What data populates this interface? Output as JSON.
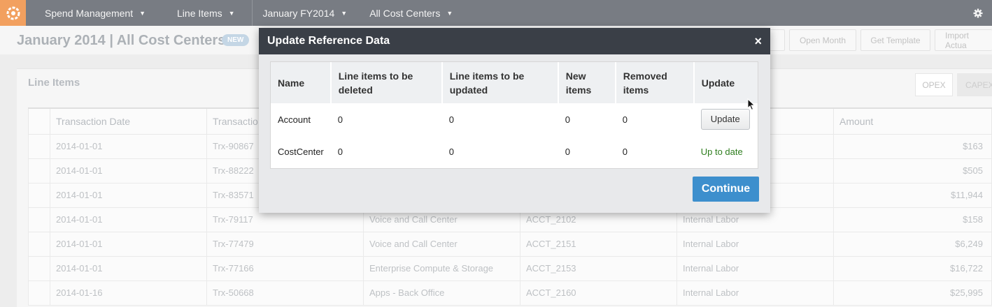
{
  "nav": {
    "items": [
      {
        "label": "Spend Management"
      },
      {
        "label": "Line Items"
      },
      {
        "label": "January FY2014"
      },
      {
        "label": "All Cost Centers"
      }
    ],
    "accent": "#ef8b3c"
  },
  "page": {
    "title": "January 2014 | All Cost Centers",
    "badge": "NEW",
    "buttons": {
      "open_month": "Open Month",
      "get_template": "Get Template",
      "import_actuals": "Import Actua"
    }
  },
  "panel": {
    "title": "Line Items",
    "tabs": {
      "opex": "OPEX",
      "capex": "CAPEX"
    }
  },
  "table": {
    "headers": {
      "date": "Transaction Date",
      "trx": "Transactio",
      "amount": "Amount"
    },
    "rows": [
      {
        "date": "2014-01-01",
        "trx": "Trx-90867",
        "service": "",
        "account": "",
        "category": "",
        "amount": "$163"
      },
      {
        "date": "2014-01-01",
        "trx": "Trx-88222",
        "service": "",
        "account": "",
        "category": "",
        "amount": "$505"
      },
      {
        "date": "2014-01-01",
        "trx": "Trx-83571",
        "service": "",
        "account": "",
        "category": "",
        "amount": "$11,944"
      },
      {
        "date": "2014-01-01",
        "trx": "Trx-79117",
        "service": "Voice and Call Center",
        "account": "ACCT_2102",
        "category": "Internal Labor",
        "amount": "$158"
      },
      {
        "date": "2014-01-01",
        "trx": "Trx-77479",
        "service": "Voice and Call Center",
        "account": "ACCT_2151",
        "category": "Internal Labor",
        "amount": "$6,249"
      },
      {
        "date": "2014-01-01",
        "trx": "Trx-77166",
        "service": "Enterprise Compute & Storage",
        "account": "ACCT_2153",
        "category": "Internal Labor",
        "amount": "$16,722"
      },
      {
        "date": "2014-01-16",
        "trx": "Trx-50668",
        "service": "Apps - Back Office",
        "account": "ACCT_2160",
        "category": "Internal Labor",
        "amount": "$25,995"
      }
    ]
  },
  "modal": {
    "title": "Update Reference Data",
    "close": "×",
    "headers": {
      "name": "Name",
      "to_delete": "Line items to be deleted",
      "to_update": "Line items to be updated",
      "new_items": "New items",
      "removed": "Removed items",
      "update": "Update"
    },
    "rows": [
      {
        "name": "Account",
        "to_delete": "0",
        "to_update": "0",
        "new_items": "0",
        "removed": "0",
        "action": "Update",
        "status": ""
      },
      {
        "name": "CostCenter",
        "to_delete": "0",
        "to_update": "0",
        "new_items": "0",
        "removed": "0",
        "action": "",
        "status": "Up to date"
      }
    ],
    "continue": "Continue",
    "status_color": "#2e7d1e",
    "primary_color": "#3d8fcd"
  }
}
